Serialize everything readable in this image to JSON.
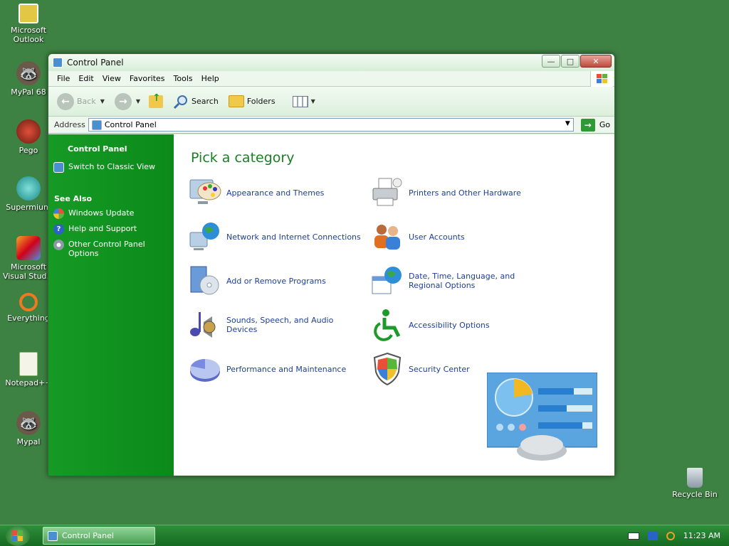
{
  "desktop": {
    "icons": [
      {
        "label": "Microsoft Outlook"
      },
      {
        "label": "MyPal 68"
      },
      {
        "label": "Pego"
      },
      {
        "label": "Supermium"
      },
      {
        "label": "Microsoft Visual Stud..."
      },
      {
        "label": "Everything"
      },
      {
        "label": "Notepad++"
      },
      {
        "label": "Mypal"
      },
      {
        "label": "Recycle Bin"
      }
    ]
  },
  "window": {
    "title": "Control Panel",
    "controls": {
      "minimize": "—",
      "maximize": "□",
      "close": "✕"
    }
  },
  "menubar": {
    "items": [
      "File",
      "Edit",
      "View",
      "Favorites",
      "Tools",
      "Help"
    ]
  },
  "toolbar": {
    "back_label": "Back",
    "search_label": "Search",
    "folders_label": "Folders"
  },
  "address": {
    "label": "Address",
    "value": "Control Panel",
    "go_label": "Go"
  },
  "sidebar": {
    "header": "Control Panel",
    "switch_view": "Switch to Classic View",
    "see_also_title": "See Also",
    "see_also": [
      {
        "label": "Windows Update"
      },
      {
        "label": "Help and Support"
      },
      {
        "label": "Other Control Panel Options"
      }
    ]
  },
  "main": {
    "title": "Pick a category",
    "categories": [
      {
        "label": "Appearance and Themes"
      },
      {
        "label": "Printers and Other Hardware"
      },
      {
        "label": "Network and Internet Connections"
      },
      {
        "label": "User Accounts"
      },
      {
        "label": "Add or Remove Programs"
      },
      {
        "label": "Date, Time, Language, and Regional Options"
      },
      {
        "label": "Sounds, Speech, and Audio Devices"
      },
      {
        "label": "Accessibility Options"
      },
      {
        "label": "Performance and Maintenance"
      },
      {
        "label": "Security Center"
      }
    ]
  },
  "taskbar": {
    "task_label": "Control Panel",
    "clock": "11:23 AM"
  }
}
